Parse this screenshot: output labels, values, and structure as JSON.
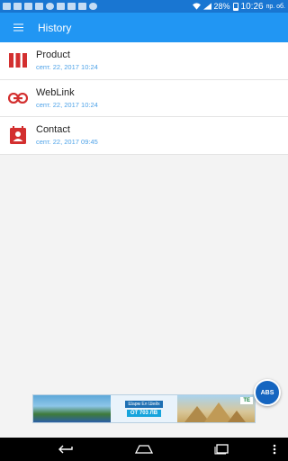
{
  "status_bar": {
    "battery": "28%",
    "time": "10:26",
    "day": "пр. об."
  },
  "app_bar": {
    "title": "History",
    "menu_icon": "menu-icon"
  },
  "history": [
    {
      "icon": "barcode-icon",
      "name": "Product",
      "date": "септ. 22, 2017 10:24"
    },
    {
      "icon": "link-icon",
      "name": "WebLink",
      "date": "септ. 22, 2017 10:24"
    },
    {
      "icon": "contact-icon",
      "name": "Contact",
      "date": "септ. 22, 2017 09:45"
    }
  ],
  "ad": {
    "headline": "Шарм Ел Шейх",
    "price": "ОТ 703 ЛВ",
    "brand": "ТЕ"
  },
  "abs_button": {
    "label": "ABS"
  },
  "nav_bar": {
    "icons": [
      "back-icon",
      "home-icon",
      "recents-icon",
      "more-icon"
    ]
  },
  "colors": {
    "primary": "#2196f3",
    "primary_dark": "#1976d2",
    "icon_red": "#d32f2f",
    "date_blue": "#4fa3e8"
  }
}
